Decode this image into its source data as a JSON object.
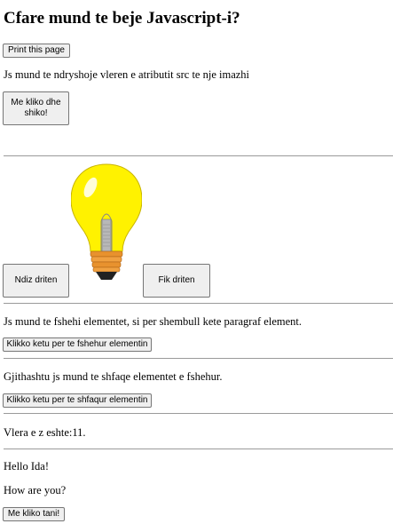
{
  "page": {
    "title": "Cfare mund te beje Javascript-i?",
    "print_button": "Print this page",
    "img_src_text": "Js mund te ndryshoje vleren e atributit src te nje imazhi",
    "click_button": "Me kliko dhe shiko!",
    "light_on_button": "Ndiz driten",
    "light_off_button": "Fik driten",
    "hide_text": "Js mund te fshehi elementet, si per shembull kete paragraf element.",
    "hide_button": "Klikko ketu per te fshehur elementin",
    "show_text": "Gjithashtu js mund te shfaqe elementet e fshehur.",
    "show_button": "Klikko ketu per te shfaqur elementin",
    "value_text": "Vlera e z eshte:11.",
    "hello_text": "Hello Ida!",
    "how_text": "How are you?",
    "now_button": "Me kliko tani!"
  },
  "colors": {
    "bulb_glass": "#fff200",
    "bulb_base": "#e8922e",
    "rule": "#9a9a9a"
  },
  "icons": {
    "bulb": "lightbulb-icon"
  }
}
